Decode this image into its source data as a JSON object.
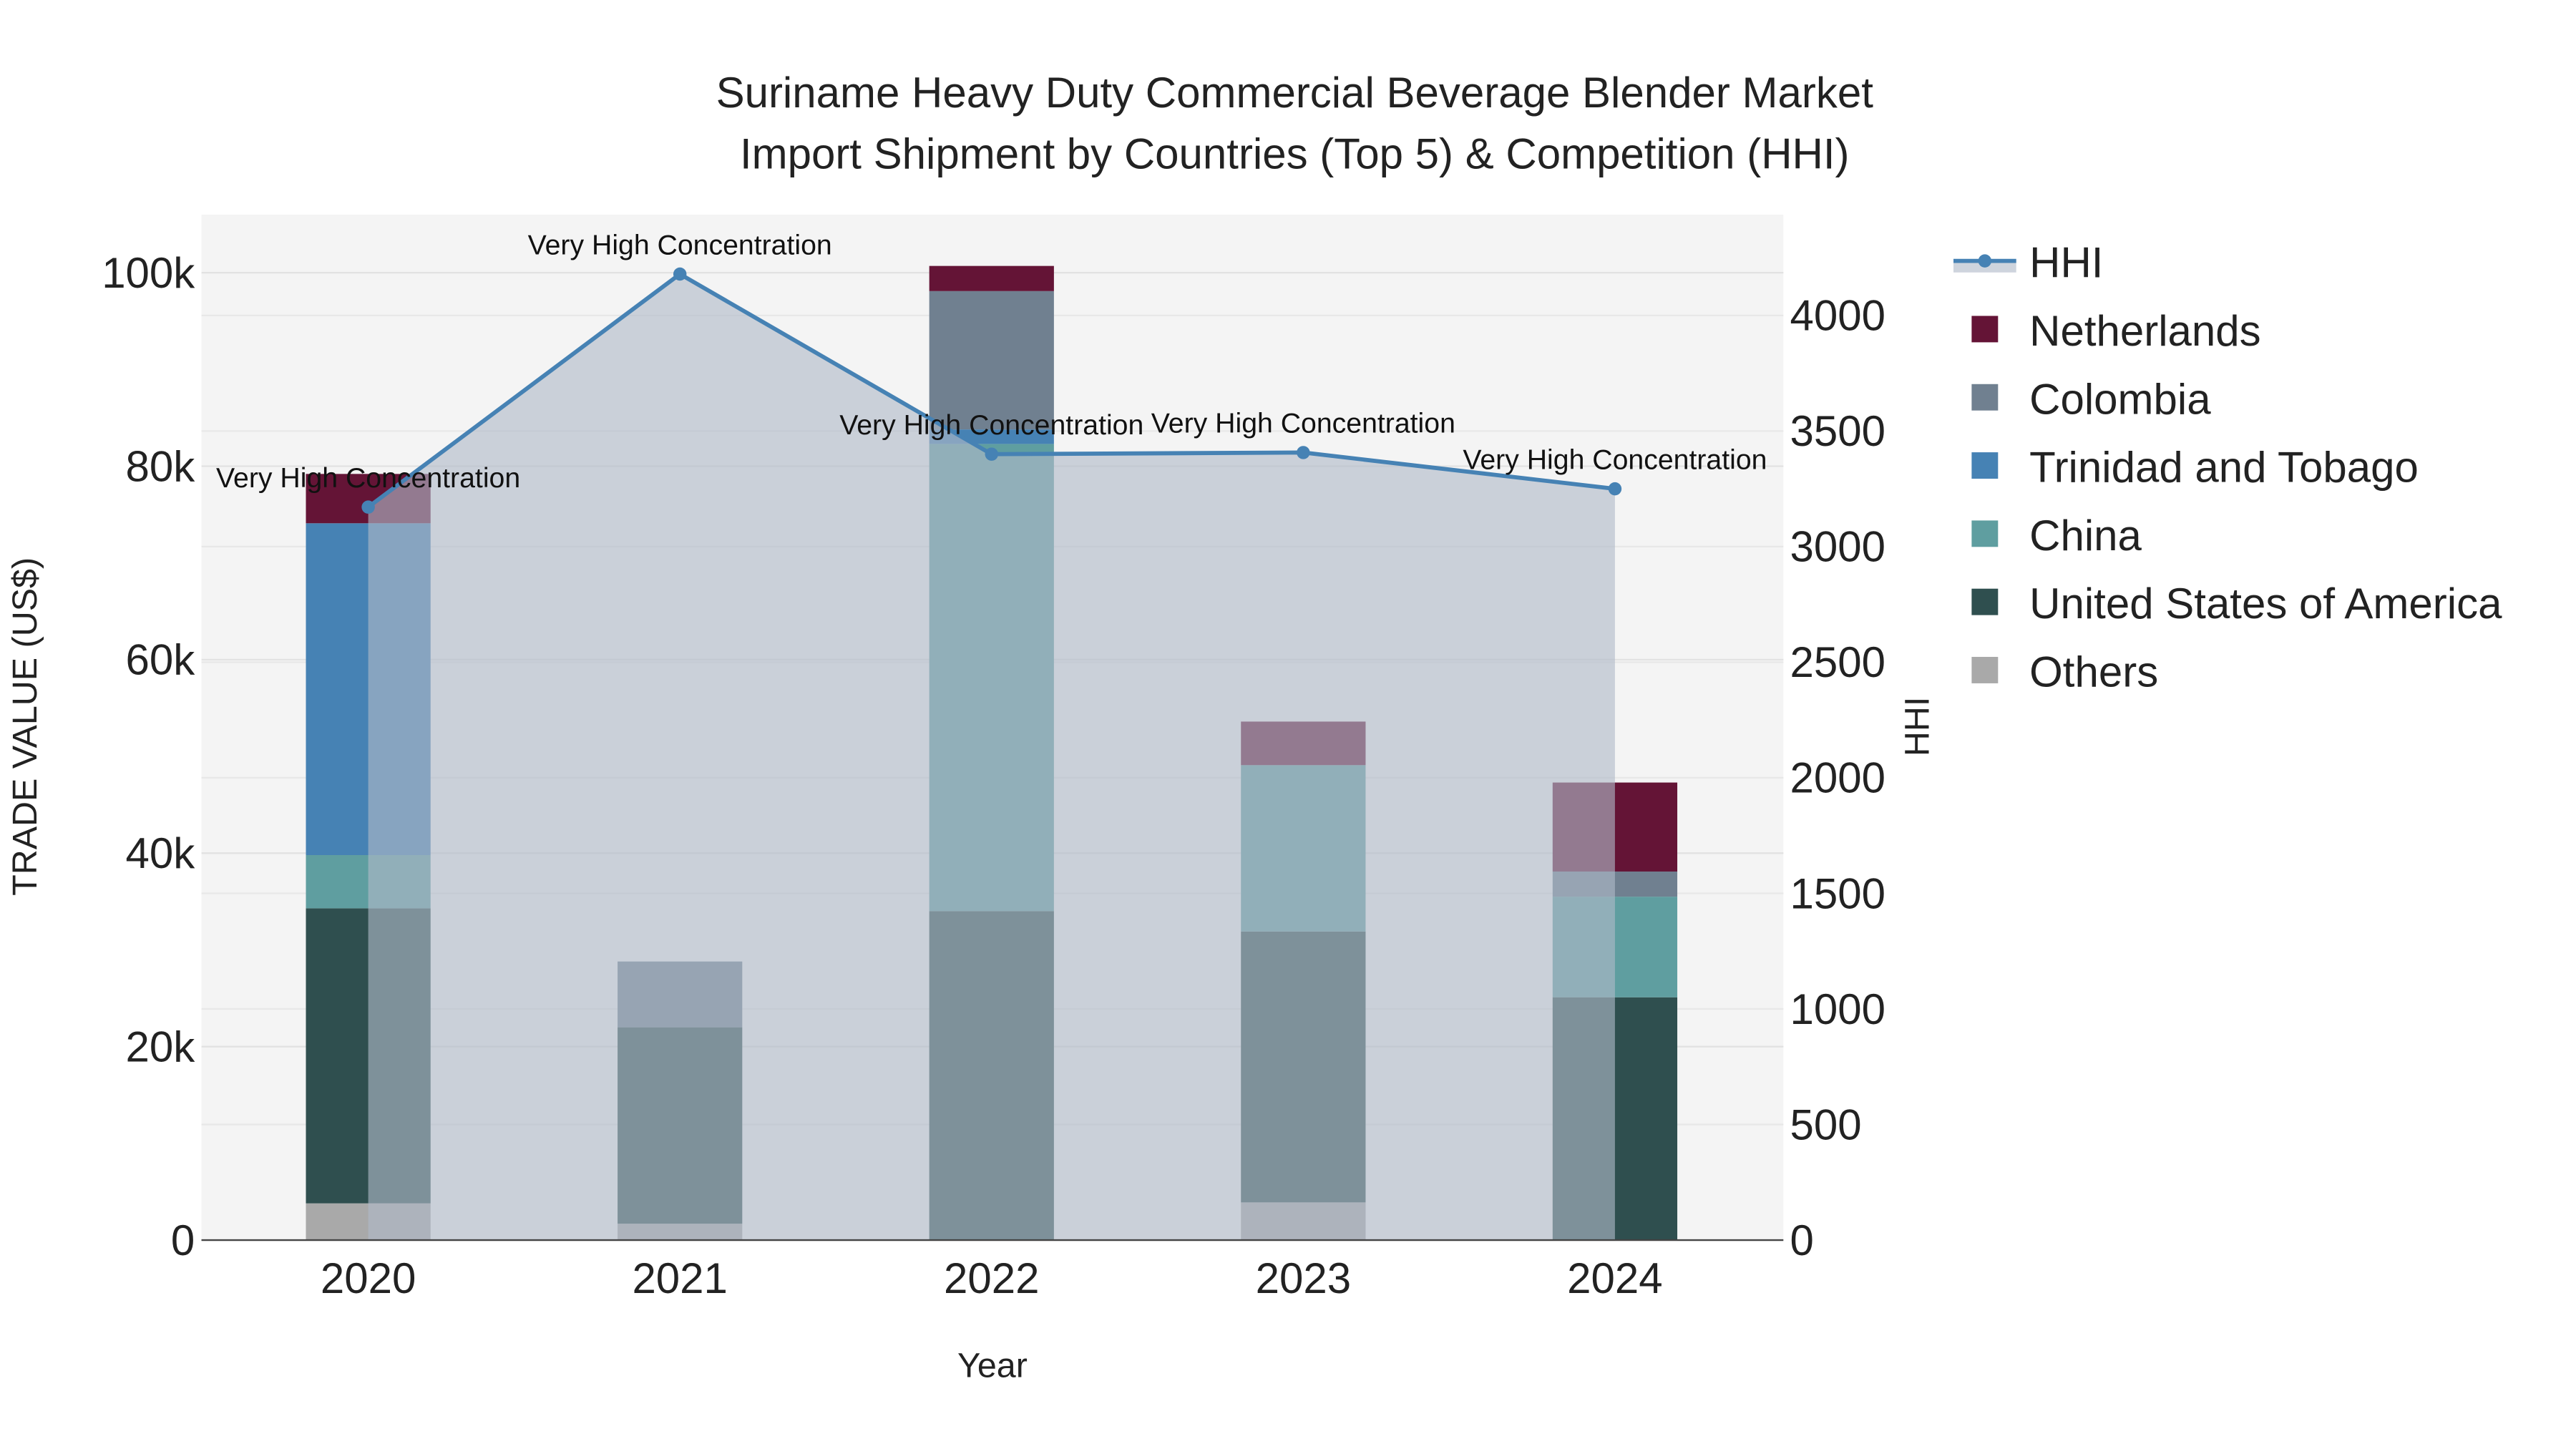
{
  "chart_data": {
    "type": "bar",
    "title_line1": "Suriname Heavy Duty Commercial Beverage Blender Market",
    "title_line2": "Import Shipment by Countries (Top 5) & Competition (HHI)",
    "xlabel": "Year",
    "ylabel": "TRADE VALUE (US$)",
    "y2label": "HHI",
    "categories": [
      "2020",
      "2021",
      "2022",
      "2023",
      "2024"
    ],
    "ylim": [
      0,
      106000
    ],
    "y2lim": [
      0,
      4436
    ],
    "yticks": [
      0,
      20000,
      40000,
      60000,
      80000,
      100000
    ],
    "ytick_labels": [
      "0",
      "20k",
      "40k",
      "60k",
      "80k",
      "100k"
    ],
    "y2ticks": [
      0,
      500,
      1000,
      1500,
      2000,
      2500,
      3000,
      3500,
      4000
    ],
    "y2tick_labels": [
      "0",
      "500",
      "1000",
      "1500",
      "2000",
      "2500",
      "3000",
      "3500",
      "4000"
    ],
    "grid": true,
    "legend_position": "right",
    "series": [
      {
        "name": "Others",
        "color": "#a9a9a9",
        "values": [
          3800,
          1700,
          0,
          3900,
          0
        ]
      },
      {
        "name": "United States of America",
        "color": "#2f4f4f",
        "values": [
          30500,
          20300,
          34000,
          28000,
          25100
        ]
      },
      {
        "name": "China",
        "color": "#5f9ea0",
        "values": [
          5500,
          0,
          48300,
          17200,
          10400
        ]
      },
      {
        "name": "Trinidad and Tobago",
        "color": "#4682b4",
        "values": [
          34300,
          0,
          1500,
          0,
          0
        ]
      },
      {
        "name": "Colombia",
        "color": "#708090",
        "values": [
          0,
          6800,
          14300,
          0,
          2600
        ]
      },
      {
        "name": "Netherlands",
        "color": "#641436",
        "values": [
          5100,
          0,
          2600,
          4500,
          9200
        ]
      }
    ],
    "line": {
      "name": "HHI",
      "color": "#4682b4",
      "values": [
        3171,
        4179,
        3400,
        3407,
        3250
      ]
    },
    "annotations": [
      "Very High Concentration",
      "Very High Concentration",
      "Very High Concentration",
      "Very High Concentration",
      "Very High Concentration"
    ],
    "legend_order": [
      "HHI",
      "Netherlands",
      "Colombia",
      "Trinidad and Tobago",
      "China",
      "United States of America",
      "Others"
    ]
  }
}
